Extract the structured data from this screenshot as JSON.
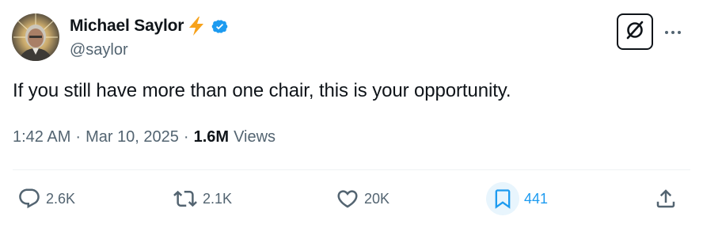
{
  "author": {
    "display_name": "Michael Saylor",
    "handle": "@saylor",
    "badges": [
      "lightning-bolt-icon",
      "verified-badge-icon"
    ]
  },
  "header_actions": {
    "grok_icon": "grok-icon",
    "more_icon": "more-icon"
  },
  "tweet": {
    "text": "If you still have more than one chair, this is your opportunity."
  },
  "meta": {
    "time": "1:42 AM",
    "separator": "·",
    "date": "Mar 10, 2025",
    "views_count": "1.6M",
    "views_label": "Views"
  },
  "actions": {
    "replies": "2.6K",
    "reposts": "2.1K",
    "likes": "20K",
    "bookmarks": "441"
  },
  "colors": {
    "text_primary": "#0f1419",
    "text_secondary": "#536471",
    "accent": "#1d9bf0",
    "bolt": "#f7a21b"
  }
}
